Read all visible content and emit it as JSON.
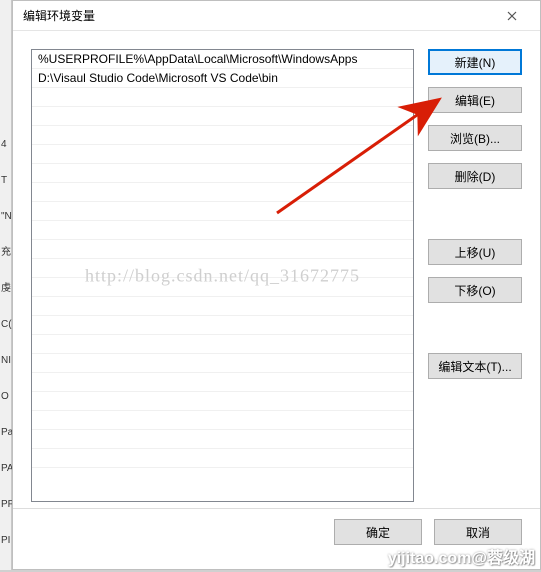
{
  "titlebar": {
    "title": "编辑环境变量"
  },
  "list": {
    "items": [
      "%USERPROFILE%\\AppData\\Local\\Microsoft\\WindowsApps",
      "D:\\Visaul Studio Code\\Microsoft VS Code\\bin"
    ]
  },
  "buttons": {
    "new": "新建(N)",
    "edit": "编辑(E)",
    "browse": "浏览(B)...",
    "delete": "删除(D)",
    "move_up": "上移(U)",
    "move_down": "下移(O)",
    "edit_text": "编辑文本(T)..."
  },
  "footer": {
    "ok": "确定",
    "cancel": "取消"
  },
  "watermark": "http://blog.csdn.net/qq_31672775",
  "bottom_watermark": "yijitao.com@蓉级湖",
  "left_letters": [
    "4",
    "",
    "",
    "T",
    "\"N",
    "",
    "",
    "",
    "",
    "充",
    "虔",
    "C(",
    "NI",
    "O",
    "Pa",
    "PA",
    "PF",
    "PI"
  ]
}
